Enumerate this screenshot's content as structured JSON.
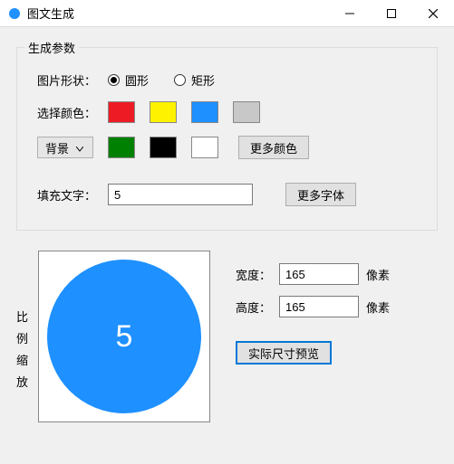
{
  "window": {
    "title": "图文生成"
  },
  "group": {
    "title": "生成参数",
    "shape": {
      "label": "图片形状：",
      "circle": "圆形",
      "rect": "矩形",
      "selected": "circle"
    },
    "color": {
      "label": "选择颜色：",
      "bg_combo": "背景",
      "more_colors": "更多颜色"
    },
    "text": {
      "label": "填充文字：",
      "value": "5",
      "more_fonts": "更多字体"
    }
  },
  "preview": {
    "scale_label": "比例缩放",
    "text": "5",
    "fill_color": "#1e90ff"
  },
  "dims": {
    "width_label": "宽度：",
    "height_label": "高度：",
    "width_value": "165",
    "height_value": "165",
    "unit": "像素",
    "actual_size_btn": "实际尺寸预览"
  }
}
